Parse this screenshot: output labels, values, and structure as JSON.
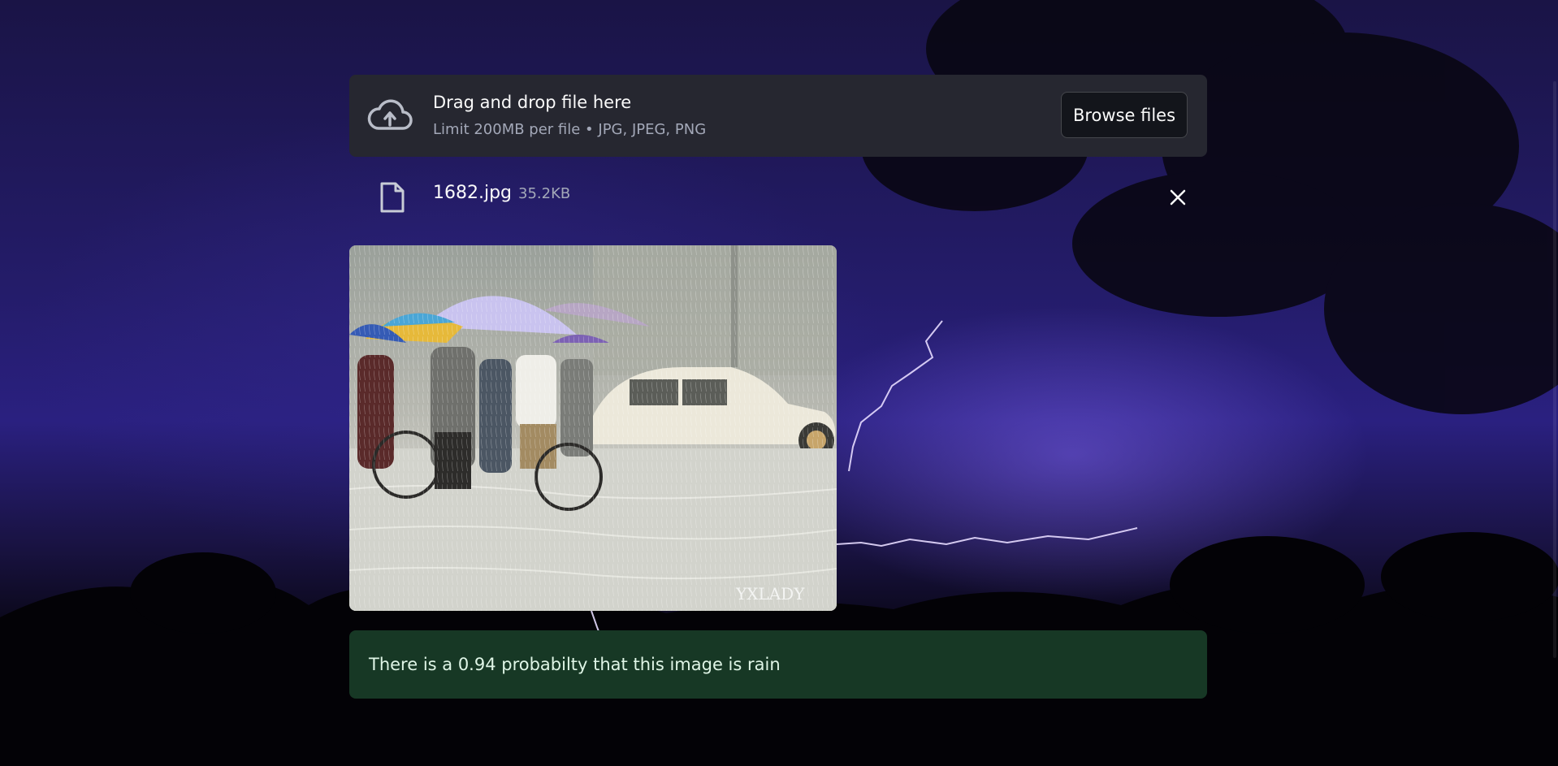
{
  "uploader": {
    "title": "Drag and drop file here",
    "limit": "Limit 200MB per file • JPG, JPEG, PNG",
    "browse_label": "Browse files",
    "icon": "cloud-upload-icon"
  },
  "file": {
    "name": "1682.jpg",
    "size": "35.2KB",
    "icon": "file-icon",
    "remove_icon": "close-icon"
  },
  "image": {
    "watermark": "YXLADY"
  },
  "result": {
    "text": "There is a 0.94 probabilty that this image is rain"
  },
  "colors": {
    "uploader_bg": "#262730",
    "result_bg": "#173825",
    "result_text": "#dff5e6"
  }
}
